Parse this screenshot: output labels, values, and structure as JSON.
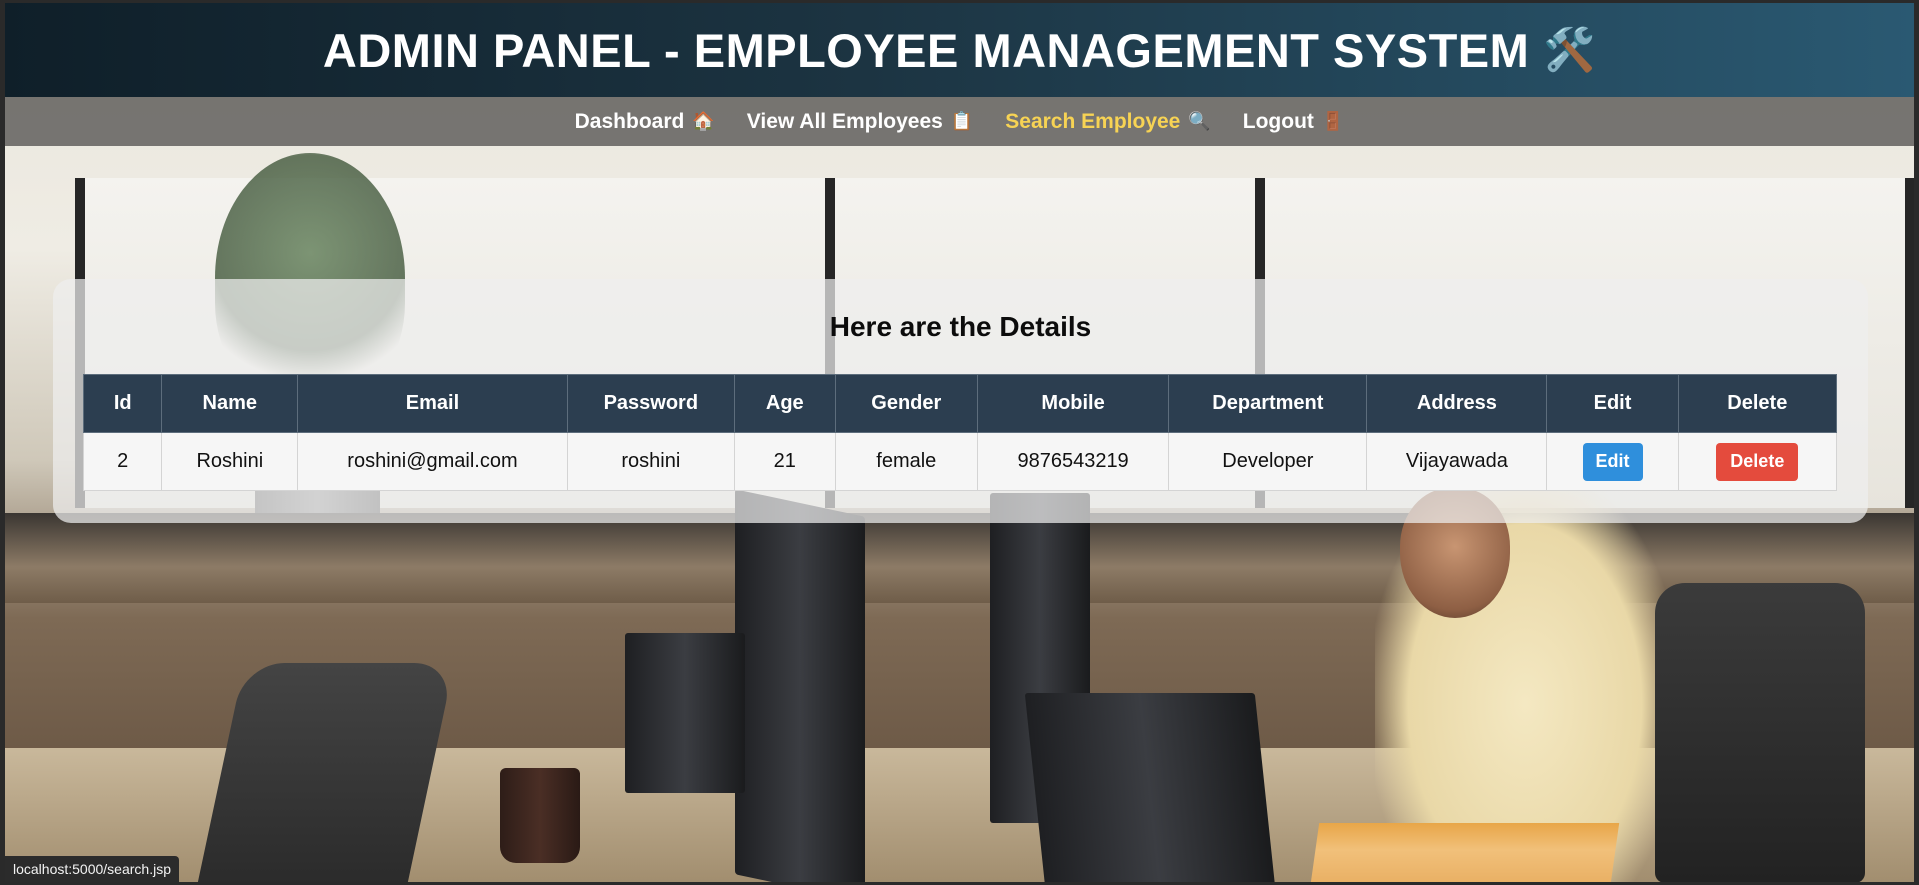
{
  "header": {
    "title": "ADMIN PANEL - EMPLOYEE MANAGEMENT SYSTEM",
    "icon": "🛠️"
  },
  "nav": {
    "items": [
      {
        "label": "Dashboard",
        "icon": "🏠",
        "active": false
      },
      {
        "label": "View All Employees",
        "icon": "📋",
        "active": false
      },
      {
        "label": "Search Employee",
        "icon": "🔍",
        "active": true
      },
      {
        "label": "Logout",
        "icon": "🚪",
        "active": false
      }
    ],
    "active_color": "#f7d354"
  },
  "details": {
    "heading": "Here are the Details",
    "columns": [
      "Id",
      "Name",
      "Email",
      "Password",
      "Age",
      "Gender",
      "Mobile",
      "Department",
      "Address",
      "Edit",
      "Delete"
    ],
    "rows": [
      {
        "id": "2",
        "name": "Roshini",
        "email": "roshini@gmail.com",
        "password": "roshini",
        "age": "21",
        "gender": "female",
        "mobile": "9876543219",
        "department": "Developer",
        "address": "Vijayawada",
        "edit_label": "Edit",
        "delete_label": "Delete"
      }
    ]
  },
  "status_bar": {
    "url": "localhost:5000/search.jsp"
  },
  "colors": {
    "header_dark": "#0f1f29",
    "header_light": "#2a5972",
    "table_header": "#2c3e50",
    "edit_button": "#2f8fdc",
    "delete_button": "#e44b3d"
  }
}
